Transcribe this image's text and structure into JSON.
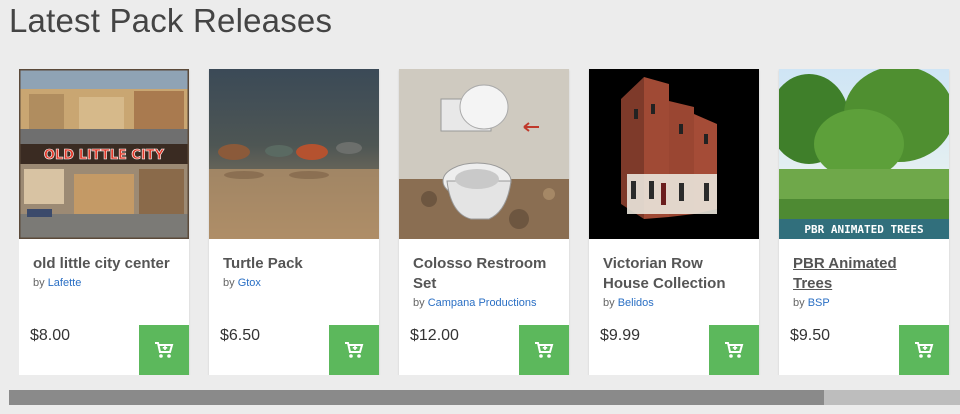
{
  "section": {
    "title": "Latest Pack Releases"
  },
  "products": [
    {
      "name": "old little city center",
      "by_prefix": "by",
      "author": "Lafette",
      "price": "$8.00",
      "thumb_text": "OLD LITTLE CITY",
      "cart_icon": "cart-plus-icon"
    },
    {
      "name": "Turtle Pack",
      "by_prefix": "by",
      "author": "Gtox",
      "price": "$6.50",
      "cart_icon": "cart-plus-icon"
    },
    {
      "name": "Colosso Restroom Set",
      "by_prefix": "by",
      "author": "Campana Productions",
      "price": "$12.00",
      "cart_icon": "cart-plus-icon"
    },
    {
      "name": "Victorian Row House Collection",
      "by_prefix": "by",
      "author": "Belidos",
      "price": "$9.99",
      "cart_icon": "cart-plus-icon"
    },
    {
      "name": "PBR Animated Trees",
      "by_prefix": "by",
      "author": "BSP",
      "price": "$9.50",
      "thumb_text": "PBR ANIMATED TREES",
      "cart_icon": "cart-plus-icon"
    }
  ],
  "scroll": {
    "position_fraction": 0.86
  },
  "colors": {
    "cart_button": "#5cb85c",
    "author_link": "#2a6fc4",
    "background": "#ececec"
  }
}
